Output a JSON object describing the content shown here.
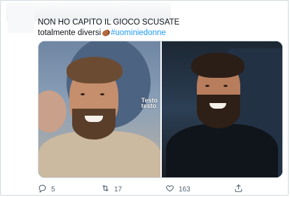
{
  "tweet": {
    "line1": "NON HO CAPITO IL GIOCO SCUSATE",
    "line2_prefix": "totalmente diversi",
    "hashtag": "#uominiedonne"
  },
  "media": {
    "watermark_line1": "Testo",
    "watermark_line2": "testo",
    "left_photo_label": "smiling man with long hair and beard",
    "right_photo_label": "smiling man with beard in dark shirt"
  },
  "actions": {
    "reply_count": "5",
    "retweet_count": "17",
    "like_count": "163"
  },
  "icons": [
    "reply-icon",
    "retweet-icon",
    "heart-icon",
    "share-icon",
    "potato-emoji-icon"
  ],
  "colors": {
    "hashtag": "#1d9bf0",
    "action_gray": "#536471",
    "text": "#0f1419"
  }
}
